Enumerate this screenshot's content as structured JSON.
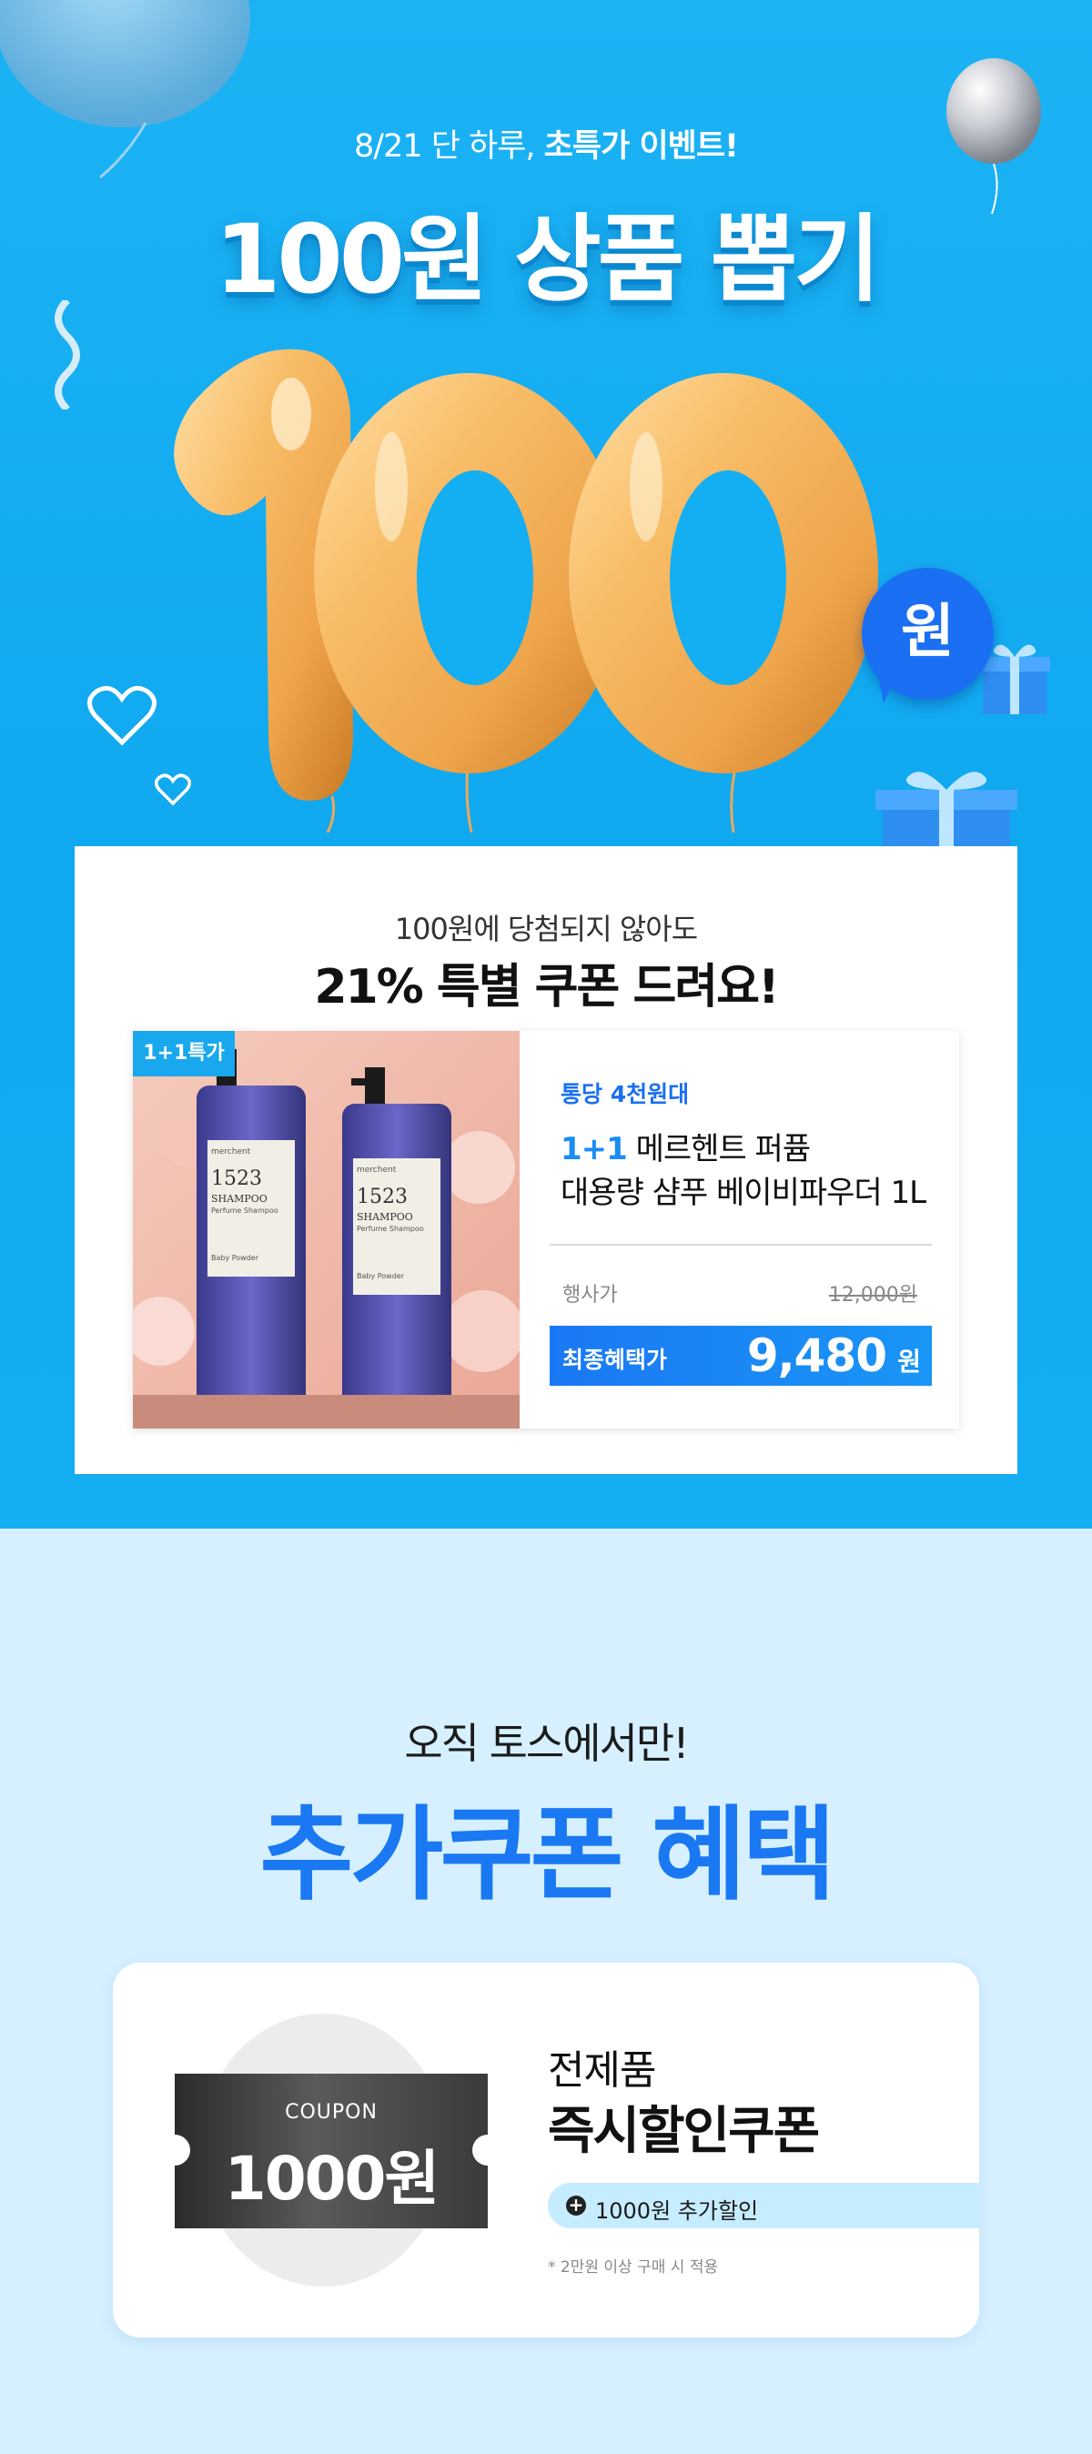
{
  "hero": {
    "subtitle_plain": "8/21 단 하루, ",
    "subtitle_bold": "초특가 이벤트!",
    "title": "100원 상품 뽑기",
    "balloon_number": "100",
    "won_badge": "원"
  },
  "card": {
    "lead": "100원에 당첨되지 않아도",
    "headline": "21% 특별 쿠폰 드려요!",
    "product": {
      "tag": "1+1특가",
      "category": "통당 4천원대",
      "name_highlight": "1+1",
      "name_rest": " 메르헨트 퍼퓸",
      "name_line2": "대용량 샴푸 베이비파우더 1L",
      "price_label": "행사가",
      "price_original": "12,000원",
      "final_label": "최종혜택가",
      "final_value": "9,480",
      "final_unit": "원",
      "bottle_brand": "merchent",
      "bottle_number": "1523",
      "bottle_type": "SHAMPOO",
      "bottle_sub": "Perfume Shampoo",
      "bottle_scent": "Baby Powder"
    }
  },
  "section2": {
    "subtitle": "오직 토스에서만!",
    "title": "추가쿠폰 혜택",
    "coupon": {
      "label": "COUPON",
      "amount": "1000원",
      "line1": "전제품",
      "line2": "즉시할인쿠폰",
      "pill_icon": "plus-icon",
      "pill_text": "1000원 추가할인",
      "note": "* 2만원 이상 구매 시 적용"
    }
  },
  "colors": {
    "hero_bg": "#14aef2",
    "accent_blue": "#1a78f2",
    "balloon_gold": "#f6b560",
    "section2_bg": "#d6f0ff"
  }
}
